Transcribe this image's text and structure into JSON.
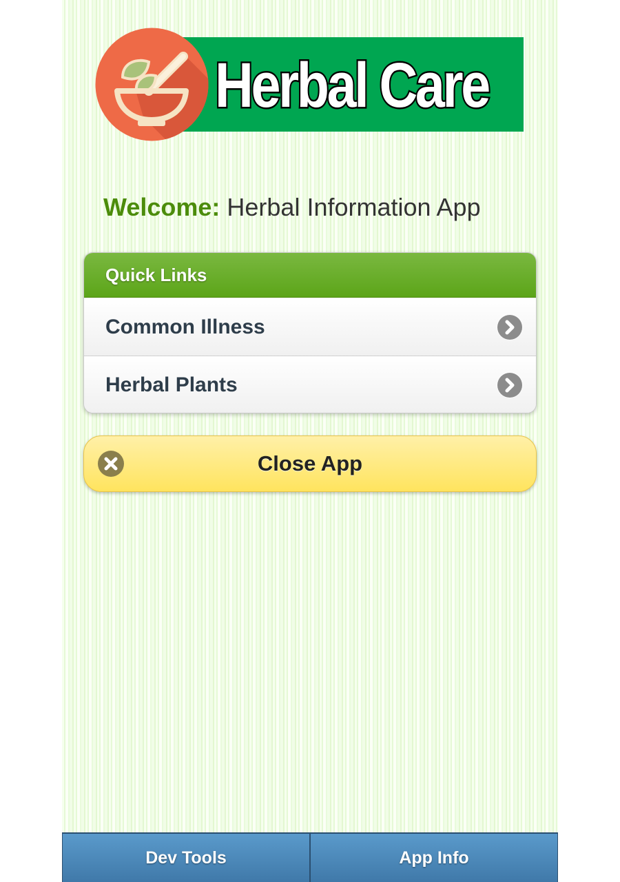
{
  "logo": {
    "text": "Herbal Care",
    "icon": "mortar-pestle-leaf-icon",
    "colors": {
      "banner": "#00a651",
      "circle": "#ee6a47"
    }
  },
  "welcome": {
    "label": "Welcome:",
    "text": " Herbal Information App"
  },
  "quick_links": {
    "title": "Quick Links",
    "items": [
      {
        "label": "Common Illness",
        "icon": "chevron-right-icon"
      },
      {
        "label": "Herbal Plants",
        "icon": "chevron-right-icon"
      }
    ]
  },
  "close_button": {
    "label": "Close App",
    "icon": "close-icon"
  },
  "footer": {
    "tabs": [
      {
        "label": "Dev Tools"
      },
      {
        "label": "App Info"
      }
    ]
  },
  "colors": {
    "accent_green": "#5ca519",
    "welcome_green": "#4c8c0b",
    "button_yellow": "#ffe45e",
    "footer_blue": "#4a86b8"
  }
}
